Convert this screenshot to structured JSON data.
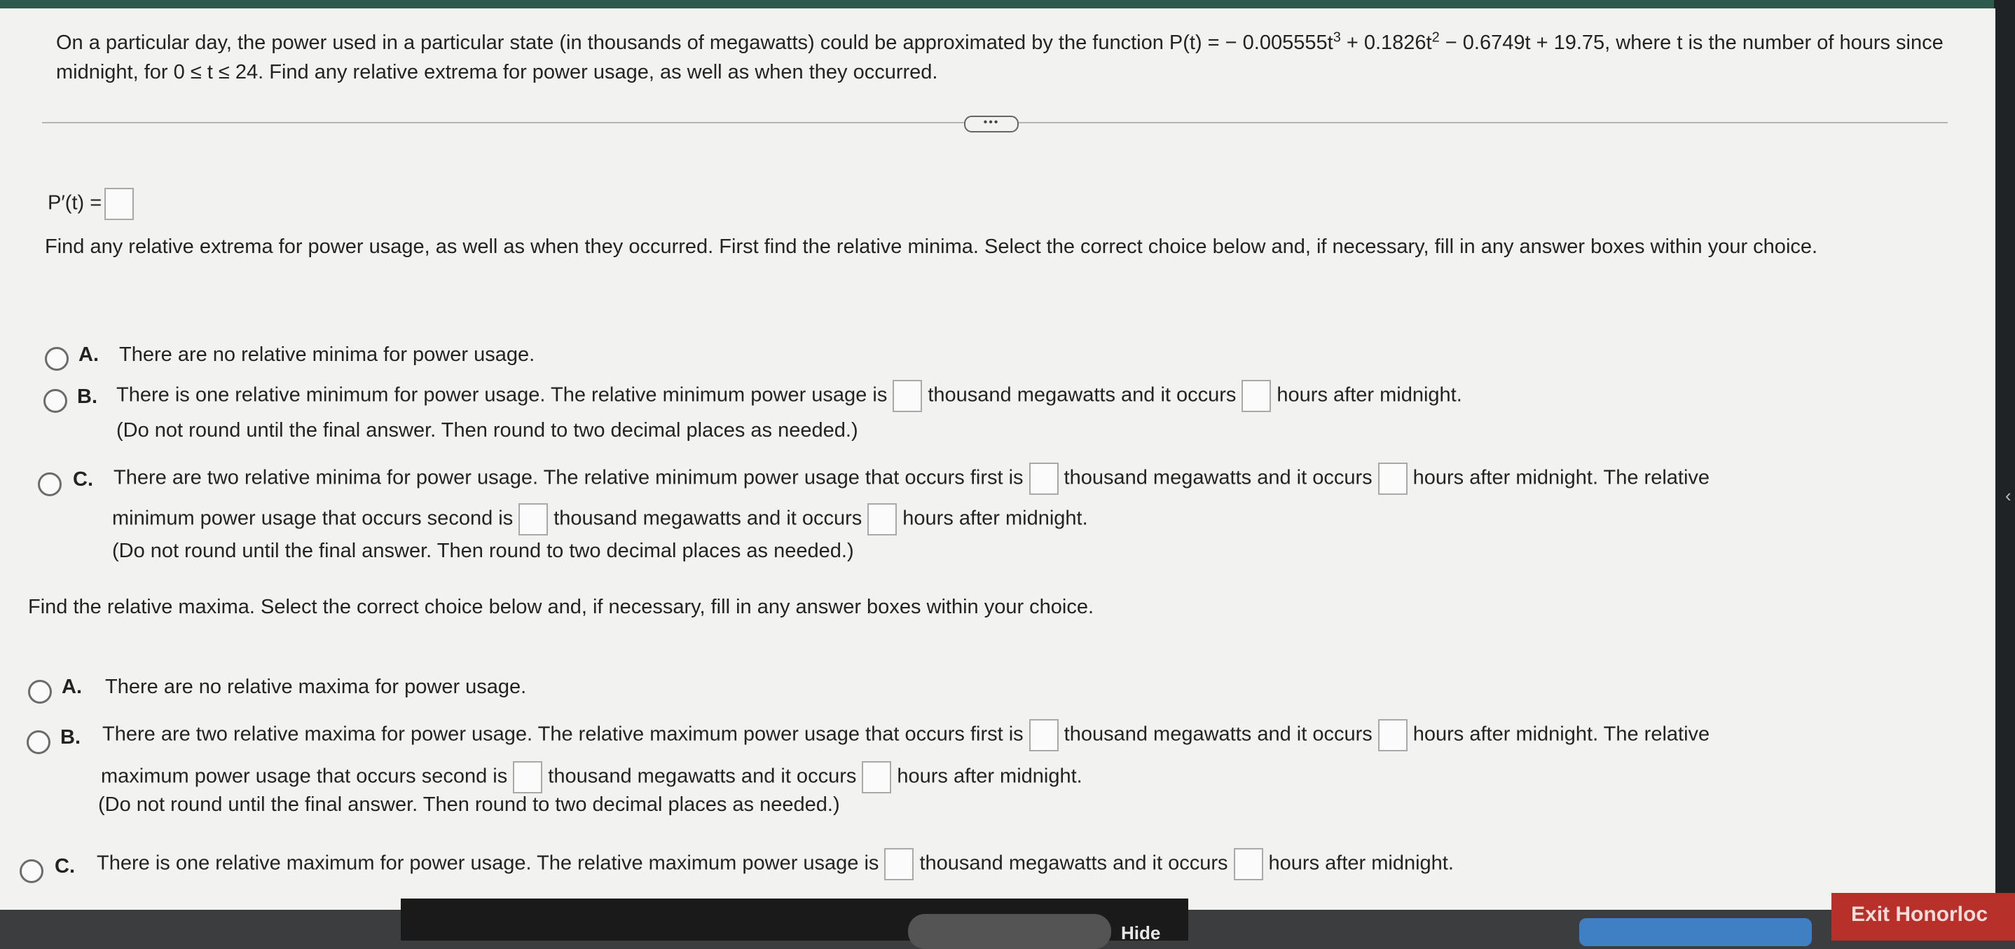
{
  "question": {
    "intro": "On a particular day, the power used in a particular state (in thousands of megawatts) could be approximated by the function P(t) = − 0.005555t",
    "exp3": "3",
    "mid1": " + 0.1826t",
    "exp2": "2",
    "mid2": " − 0.6749t + 19.75, where t is the number of hours since midnight, for 0 ≤ t ≤ 24. Find any relative extrema for power usage, as well as when they occurred."
  },
  "more_button": "•••",
  "derivative_label": "P′(t) =",
  "minima": {
    "instruction": "Find any relative extrema for power usage, as well as when they occurred. First find the relative minima. Select the correct choice below and, if necessary, fill in any answer boxes within your choice.",
    "a_letter": "A.",
    "a_text": "There are no relative minima for power usage.",
    "b_letter": "B.",
    "b_text1": "There is one relative minimum for power usage. The relative minimum power usage is",
    "b_text2": "thousand megawatts and it occurs",
    "b_text3": "hours after midnight.",
    "b_note": "(Do not round until the final answer. Then round to two decimal places as needed.)",
    "c_letter": "C.",
    "c_text1": "There are two relative minima for power usage. The relative minimum power usage that occurs first is",
    "c_text2": "thousand megawatts and it occurs",
    "c_text3": "hours after midnight. The relative",
    "c_text4": "minimum power usage that occurs second is",
    "c_text5": "thousand megawatts and it occurs",
    "c_text6": "hours after midnight.",
    "c_note": "(Do not round until the final answer. Then round to two decimal places as needed.)"
  },
  "maxima": {
    "instruction": "Find the relative maxima. Select the correct choice below and, if necessary, fill in any answer boxes within your choice.",
    "a_letter": "A.",
    "a_text": "There are no relative maxima for power usage.",
    "b_letter": "B.",
    "b_text1": "There are two relative maxima for power usage. The relative maximum power usage that occurs first is",
    "b_text2": "thousand megawatts and it occurs",
    "b_text3": "hours after midnight. The relative",
    "b_text4": "maximum power usage that occurs second is",
    "b_text5": "thousand megawatts and it occurs",
    "b_text6": "hours after midnight.",
    "b_note": "(Do not round until the final answer. Then round to two decimal places as needed.)",
    "c_letter": "C.",
    "c_text1": "There is one relative maximum for power usage. The relative maximum power usage is",
    "c_text2": "thousand megawatts and it occurs",
    "c_text3": "hours after midnight."
  },
  "bottom": {
    "hide_label": "Hide",
    "exit_label": "Exit Honorloc"
  }
}
